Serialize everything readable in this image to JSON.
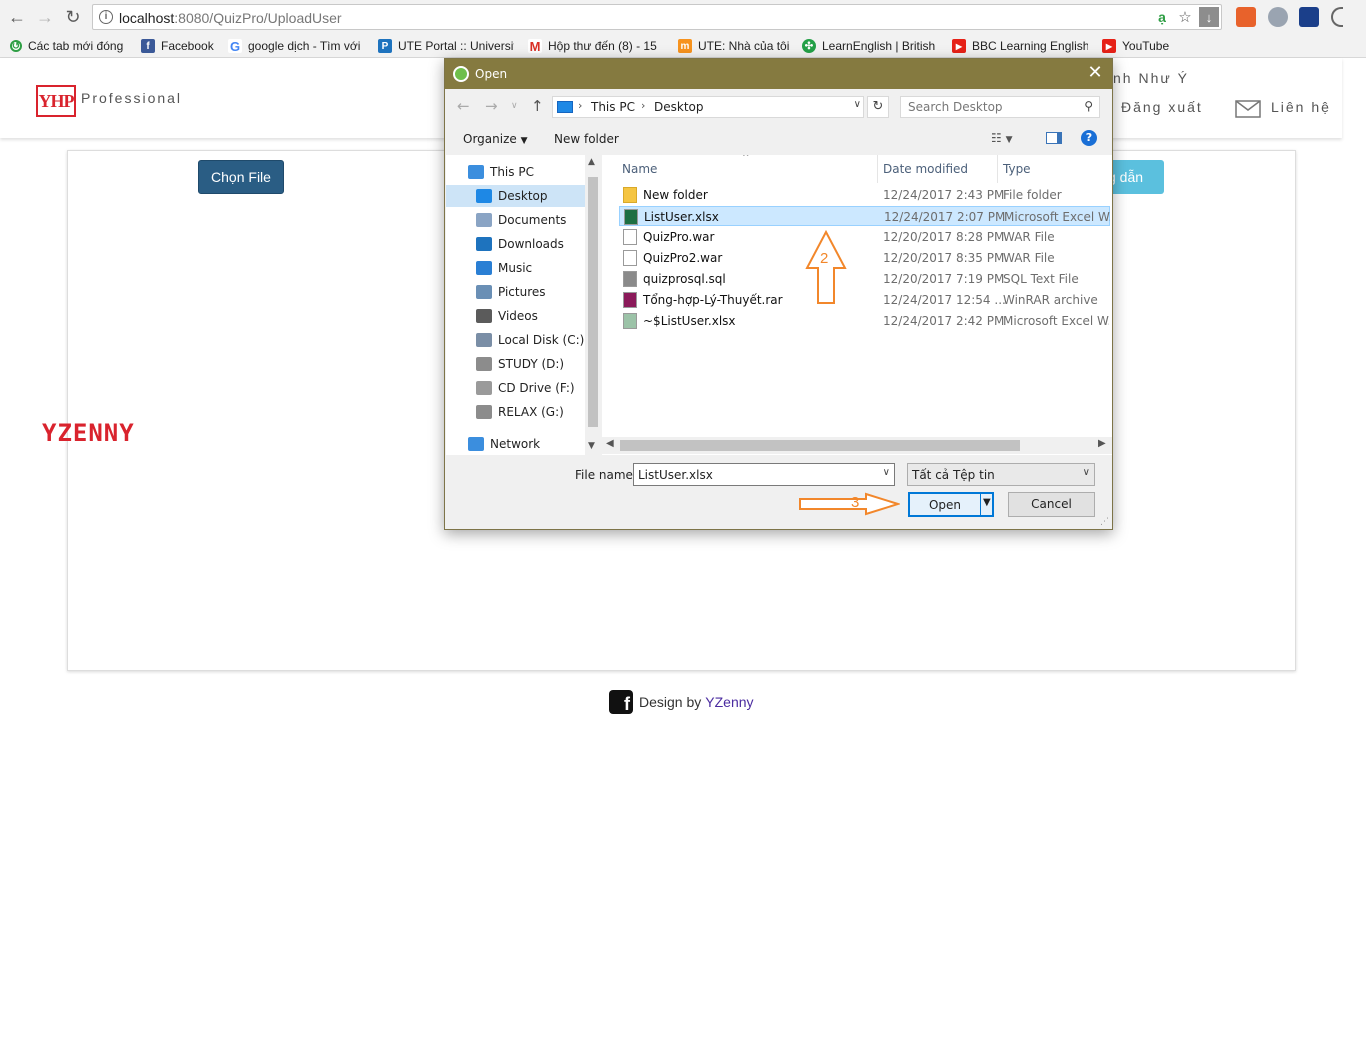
{
  "browser": {
    "url_host": "localhost",
    "url_rest": ":8080/QuizPro/UploadUser",
    "bookmarks": [
      {
        "label": "Các tab mới đóng",
        "icon": "recent-tabs-icon",
        "color": "#2e9e44"
      },
      {
        "label": "Facebook",
        "icon": "facebook-icon",
        "color": "#3b5998"
      },
      {
        "label": "google dịch - Tìm với",
        "icon": "google-icon",
        "color": "#4285f4"
      },
      {
        "label": "UTE Portal :: Universit",
        "icon": "ute-portal-icon",
        "color": "#1e73be"
      },
      {
        "label": "Hộp thư đến (8) - 15",
        "icon": "gmail-icon",
        "color": "#d93025"
      },
      {
        "label": "UTE: Nhà của tôi",
        "icon": "moodle-icon",
        "color": "#f7931e"
      },
      {
        "label": "LearnEnglish | British",
        "icon": "british-council-icon",
        "color": "#23a047"
      },
      {
        "label": "BBC Learning English",
        "icon": "youtube-icon",
        "color": "#e62117"
      },
      {
        "label": "YouTube",
        "icon": "youtube-icon",
        "color": "#e62117"
      }
    ]
  },
  "site": {
    "logo_text": "YHP",
    "brand": "Professional",
    "nav_partial": "nh Như Ý",
    "logout": "Đăng xuất",
    "contact": "Liên hệ",
    "choose_file": "Chọn File",
    "guide_partial": "g dẫn",
    "watermark": "YZENNY",
    "footer_prefix": "Design by",
    "footer_author": "YZenny",
    "accent": "#2a5d84",
    "info_color": "#5bc0de",
    "brand_red": "#d9232d"
  },
  "dialog": {
    "title": "Open",
    "breadcrumb": [
      "This PC",
      "Desktop"
    ],
    "search_placeholder": "Search Desktop",
    "organize": "Organize",
    "new_folder": "New folder",
    "help": "?",
    "nav_items": [
      {
        "label": "This PC",
        "icon": "this-pc-icon",
        "color": "#3b8ede"
      },
      {
        "label": "Desktop",
        "icon": "desktop-icon",
        "color": "#1e88e5",
        "selected": true
      },
      {
        "label": "Documents",
        "icon": "documents-icon",
        "color": "#8aa4c4"
      },
      {
        "label": "Downloads",
        "icon": "downloads-icon",
        "color": "#1e73be"
      },
      {
        "label": "Music",
        "icon": "music-icon",
        "color": "#2a7fd4"
      },
      {
        "label": "Pictures",
        "icon": "pictures-icon",
        "color": "#6a8fb5"
      },
      {
        "label": "Videos",
        "icon": "videos-icon",
        "color": "#5b5b5b"
      },
      {
        "label": "Local Disk (C:)",
        "icon": "local-disk-icon",
        "color": "#7a8ea6"
      },
      {
        "label": "STUDY (D:)",
        "icon": "drive-icon",
        "color": "#8c8c8c"
      },
      {
        "label": "CD Drive (F:)",
        "icon": "cd-drive-icon",
        "color": "#9a9a9a"
      },
      {
        "label": "RELAX (G:)",
        "icon": "drive-icon",
        "color": "#8c8c8c"
      },
      {
        "label": "Network",
        "icon": "network-icon",
        "color": "#3b8ede"
      }
    ],
    "columns": [
      "Name",
      "Date modified",
      "Type"
    ],
    "files": [
      {
        "name": "New folder",
        "date": "12/24/2017 2:43 PM",
        "type": "File folder",
        "icon": "folder-icon",
        "color": "#f5c542"
      },
      {
        "name": "ListUser.xlsx",
        "date": "12/24/2017 2:07 PM",
        "type": "Microsoft Excel W...",
        "icon": "excel-icon",
        "color": "#1d6f42",
        "selected": true
      },
      {
        "name": "QuizPro.war",
        "date": "12/20/2017 8:28 PM",
        "type": "WAR File",
        "icon": "file-icon",
        "color": "#ffffff"
      },
      {
        "name": "QuizPro2.war",
        "date": "12/20/2017 8:35 PM",
        "type": "WAR File",
        "icon": "file-icon",
        "color": "#ffffff"
      },
      {
        "name": "quizprosql.sql",
        "date": "12/20/2017 7:19 PM",
        "type": "SQL Text File",
        "icon": "sql-file-icon",
        "color": "#8a8a8a"
      },
      {
        "name": "Tổng-hợp-Lý-Thuyết.rar",
        "date": "12/24/2017 12:54 ...",
        "type": "WinRAR archive",
        "icon": "winrar-icon",
        "color": "#8b1a5a"
      },
      {
        "name": "~$ListUser.xlsx",
        "date": "12/24/2017 2:42 PM",
        "type": "Microsoft Excel W...",
        "icon": "excel-icon",
        "color": "#9cc3a8"
      }
    ],
    "file_name_label": "File name:",
    "file_name_value": "ListUser.xlsx",
    "filter_value": "Tất cả Tệp tin",
    "open_button": "Open",
    "cancel_button": "Cancel"
  },
  "annotations": {
    "step2": "2",
    "step3": "3",
    "color": "#f2872b"
  }
}
